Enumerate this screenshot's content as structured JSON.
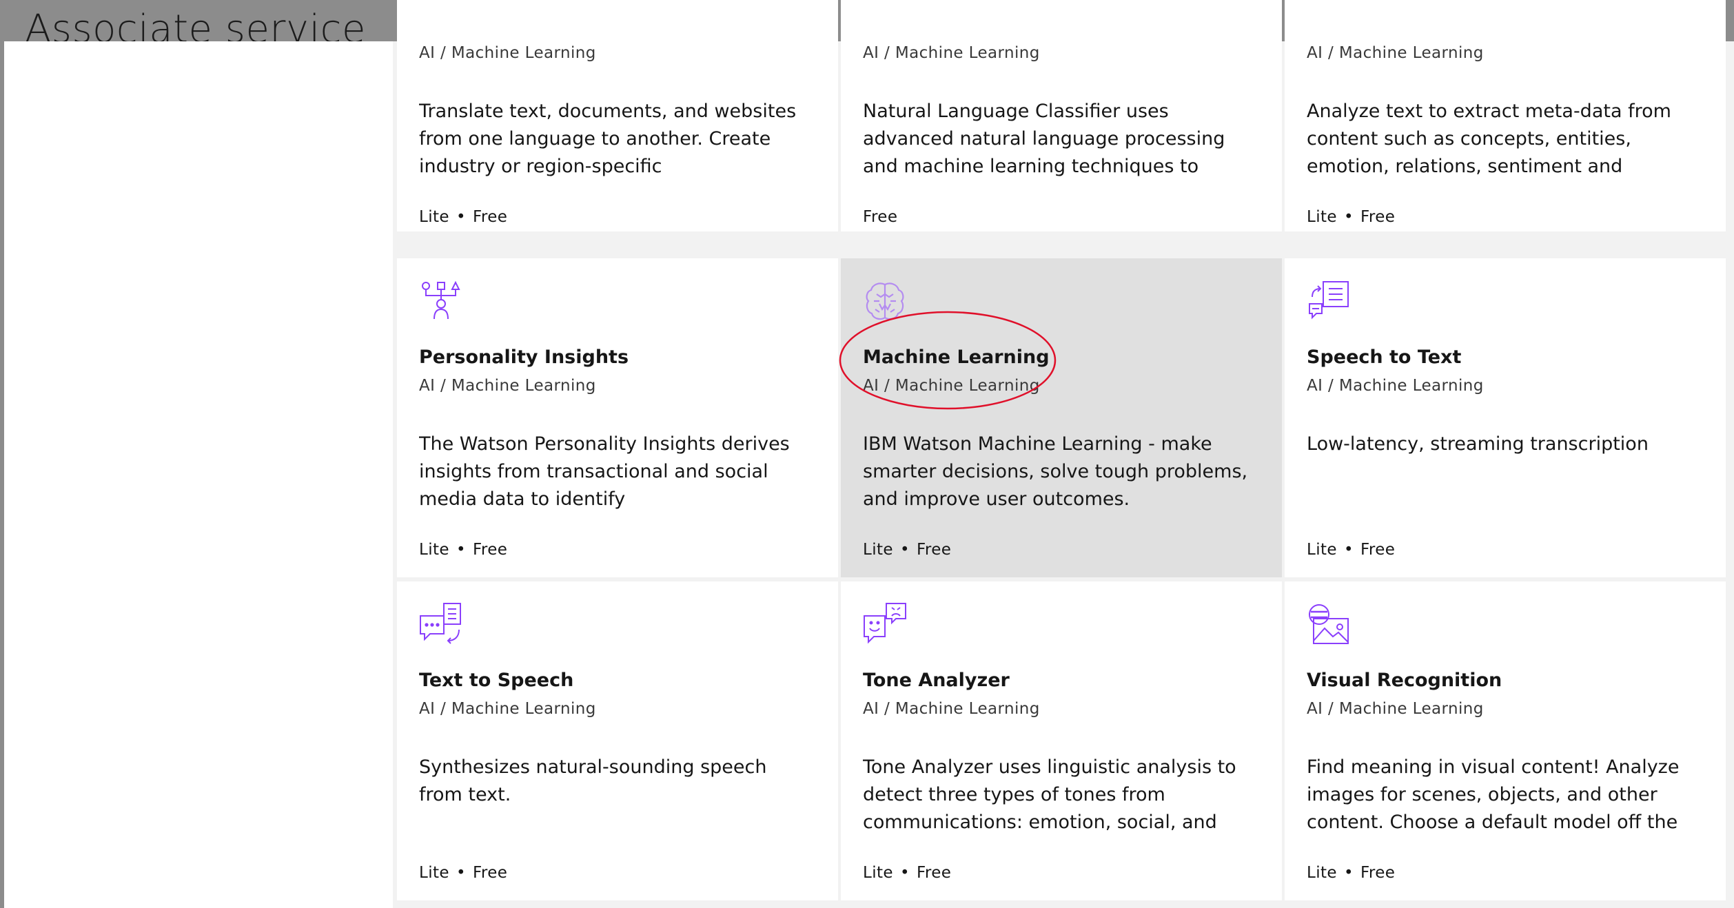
{
  "header": {
    "title": "Associate service"
  },
  "tiles": [
    {
      "name": "",
      "category": "AI / Machine Learning",
      "description": "Translate text, documents, and websites from one language to another. Create industry or region-specific",
      "plan1": "Lite",
      "plan2": "Free"
    },
    {
      "name": "",
      "category": "AI / Machine Learning",
      "description": "Natural Language Classifier uses advanced natural language processing and machine learning techniques to",
      "plan1": "Free",
      "plan2": ""
    },
    {
      "name": "",
      "category": "AI / Machine Learning",
      "description": "Analyze text to extract meta-data from content such as concepts, entities, emotion, relations, sentiment and",
      "plan1": "Lite",
      "plan2": "Free"
    },
    {
      "name": "Personality Insights",
      "category": "AI / Machine Learning",
      "description": "The Watson Personality Insights derives insights from transactional and social media data to identify",
      "plan1": "Lite",
      "plan2": "Free",
      "icon": "personality-insights-icon"
    },
    {
      "name": "Machine Learning",
      "category": "AI / Machine Learning",
      "description": "IBM Watson Machine Learning - make smarter decisions, solve tough problems, and improve user outcomes.",
      "plan1": "Lite",
      "plan2": "Free",
      "icon": "machine-learning-brain-icon",
      "selected": true
    },
    {
      "name": "Speech to Text",
      "category": "AI / Machine Learning",
      "description": "Low-latency, streaming transcription",
      "plan1": "Lite",
      "plan2": "Free",
      "icon": "speech-to-text-icon"
    },
    {
      "name": "Text to Speech",
      "category": "AI / Machine Learning",
      "description": "Synthesizes natural-sounding speech from text.",
      "plan1": "Lite",
      "plan2": "Free",
      "icon": "text-to-speech-icon"
    },
    {
      "name": "Tone Analyzer",
      "category": "AI / Machine Learning",
      "description": "Tone Analyzer uses linguistic analysis to detect three types of tones from communications: emotion, social, and",
      "plan1": "Lite",
      "plan2": "Free",
      "icon": "tone-analyzer-icon"
    },
    {
      "name": "Visual Recognition",
      "category": "AI / Machine Learning",
      "description": "Find meaning in visual content! Analyze images for scenes, objects, and other content. Choose a default model off the",
      "plan1": "Lite",
      "plan2": "Free",
      "icon": "visual-recognition-icon"
    }
  ],
  "plan_separator": "•",
  "colors": {
    "icon_purple": "#8a3ffc",
    "selected_bg": "#e0e0e0",
    "highlight_ring": "#e0102a"
  }
}
